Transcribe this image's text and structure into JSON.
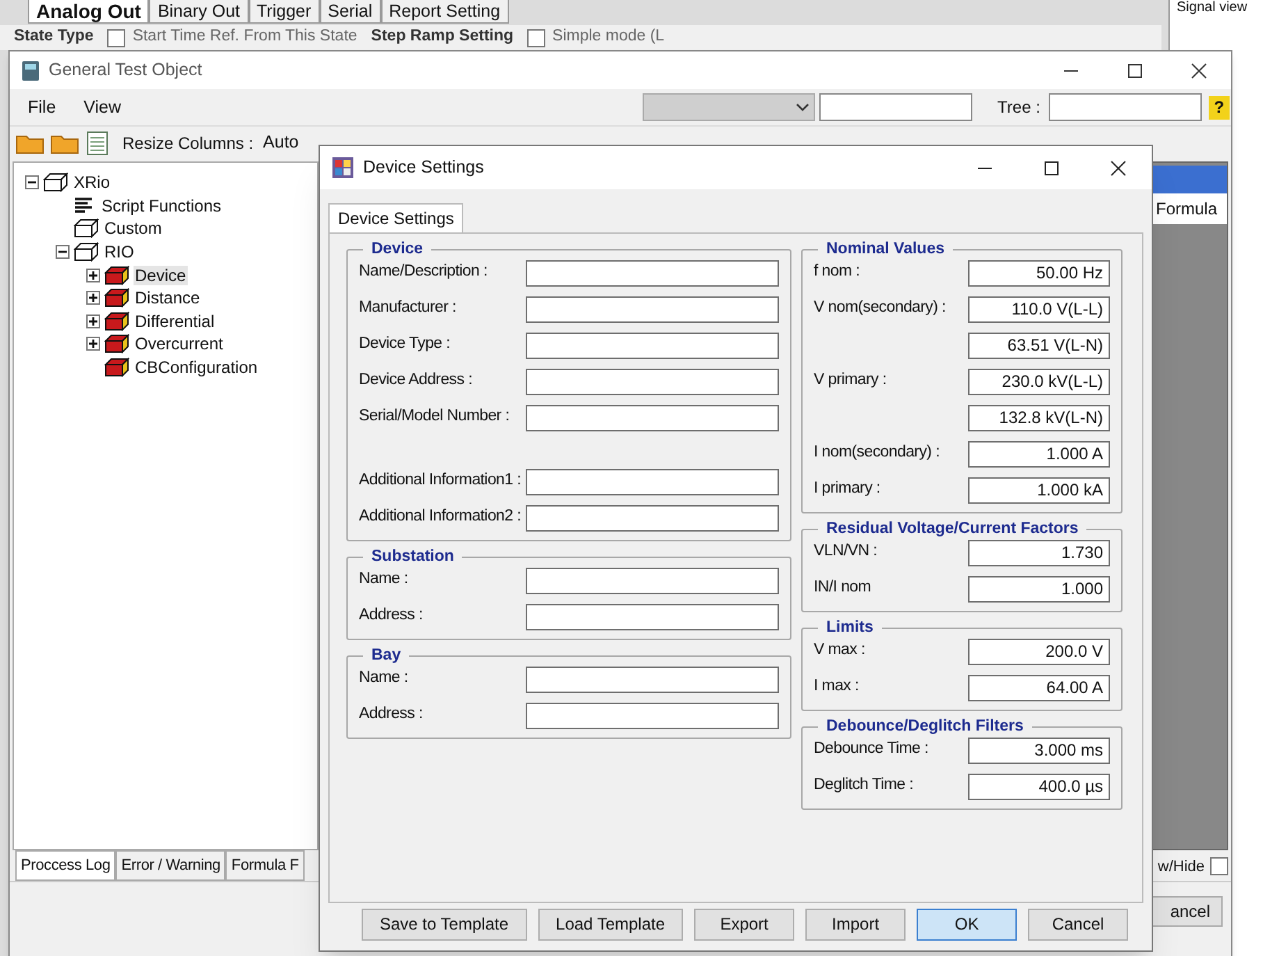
{
  "background": {
    "tabs": [
      {
        "label": "Analog Out",
        "selected": true
      },
      {
        "label": "Binary Out",
        "selected": false
      },
      {
        "label": "Trigger",
        "selected": false
      },
      {
        "label": "Serial",
        "selected": false
      },
      {
        "label": "Report Setting",
        "selected": false
      }
    ],
    "options": [
      {
        "kind": "heading",
        "label": "State Type"
      },
      {
        "kind": "checkbox",
        "label": "Start Time Ref. From This State",
        "checked": false
      },
      {
        "kind": "heading",
        "label": "Step Ramp Setting"
      },
      {
        "kind": "checkbox",
        "label": "Simple mode (L",
        "checked": false
      }
    ],
    "side_title": "Signal view"
  },
  "window": {
    "title": "General Test Object",
    "menu": [
      "File",
      "View"
    ],
    "tree_label": "Tree :",
    "resize_label": "Resize Columns :",
    "resize_value": "Auto",
    "help_label": "?",
    "tree": [
      {
        "label": "XRio",
        "kind": "box",
        "expanded": true,
        "selected": false,
        "children": [
          {
            "label": "Script Functions",
            "kind": "list",
            "selected": false
          },
          {
            "label": "Custom",
            "kind": "box",
            "selected": false
          },
          {
            "label": "RIO",
            "kind": "box",
            "expanded": true,
            "selected": false,
            "children": [
              {
                "label": "Device",
                "kind": "red-box",
                "expanded": false,
                "selected": true
              },
              {
                "label": "Distance",
                "kind": "red-box",
                "expanded": false,
                "selected": false
              },
              {
                "label": "Differential",
                "kind": "red-box",
                "expanded": false,
                "selected": false
              },
              {
                "label": "Overcurrent",
                "kind": "red-box",
                "expanded": false,
                "selected": false
              },
              {
                "label": "CBConfiguration",
                "kind": "red-box",
                "selected": false
              }
            ]
          }
        ]
      }
    ],
    "column_header": "Formula",
    "bottom_tabs": [
      {
        "label": "Proccess Log",
        "selected": true
      },
      {
        "label": "Error / Warning",
        "selected": false
      },
      {
        "label": "Formula F",
        "selected": false
      }
    ],
    "show_hide": {
      "label": "w/Hide",
      "checked": false
    },
    "cancel_label": "ancel"
  },
  "dialog": {
    "title": "Device Settings",
    "tab": {
      "label": "Device Settings",
      "selected": true
    },
    "left_groups": [
      {
        "title": "Device",
        "field_sets": [
          [
            {
              "label": "Name/Description :"
            },
            {
              "label": "Manufacturer :"
            },
            {
              "label": "Device Type :"
            },
            {
              "label": "Device Address :"
            },
            {
              "label": "Serial/Model Number :"
            }
          ],
          [
            {
              "label": "Additional Information1 :"
            },
            {
              "label": "Additional Information2 :"
            }
          ]
        ]
      },
      {
        "title": "Substation",
        "field_sets": [
          [
            {
              "label": "Name :"
            },
            {
              "label": "Address :"
            }
          ]
        ]
      },
      {
        "title": "Bay",
        "field_sets": [
          [
            {
              "label": "Name :"
            },
            {
              "label": "Address :"
            }
          ]
        ]
      }
    ],
    "right_groups": [
      {
        "title": "Nominal Values",
        "field_sets": [
          [
            {
              "label": "f nom :",
              "value": "50.00 Hz"
            },
            {
              "label": "V nom(secondary) :",
              "value": "110.0 V(L-L)"
            },
            {
              "value": "63.51 V(L-N)"
            },
            {
              "label": "V primary :",
              "value": "230.0 kV(L-L)"
            },
            {
              "value": "132.8 kV(L-N)"
            },
            {
              "label": "I nom(secondary) :",
              "value": "1.000 A"
            },
            {
              "label": "I primary :",
              "value": "1.000 kA"
            }
          ]
        ]
      },
      {
        "title": "Residual Voltage/Current Factors",
        "field_sets": [
          [
            {
              "label": "VLN/VN :",
              "value": "1.730"
            },
            {
              "label": "IN/I nom",
              "value": "1.000"
            }
          ]
        ]
      },
      {
        "title": "Limits",
        "field_sets": [
          [
            {
              "label": "V max :",
              "value": "200.0 V"
            },
            {
              "label": "I max :",
              "value": "64.00 A"
            }
          ]
        ]
      },
      {
        "title": "Debounce/Deglitch Filters",
        "field_sets": [
          [
            {
              "label": "Debounce Time :",
              "value": "3.000 ms"
            },
            {
              "label": "Deglitch Time :",
              "value": "400.0 µs"
            }
          ]
        ]
      }
    ],
    "buttons": [
      {
        "label": "Save to Template",
        "focused": false
      },
      {
        "label": "Load Template",
        "focused": false
      },
      {
        "label": "Export",
        "focused": false
      },
      {
        "label": "Import",
        "focused": false
      },
      {
        "label": "OK",
        "focused": true
      },
      {
        "label": "Cancel",
        "focused": false
      }
    ]
  }
}
